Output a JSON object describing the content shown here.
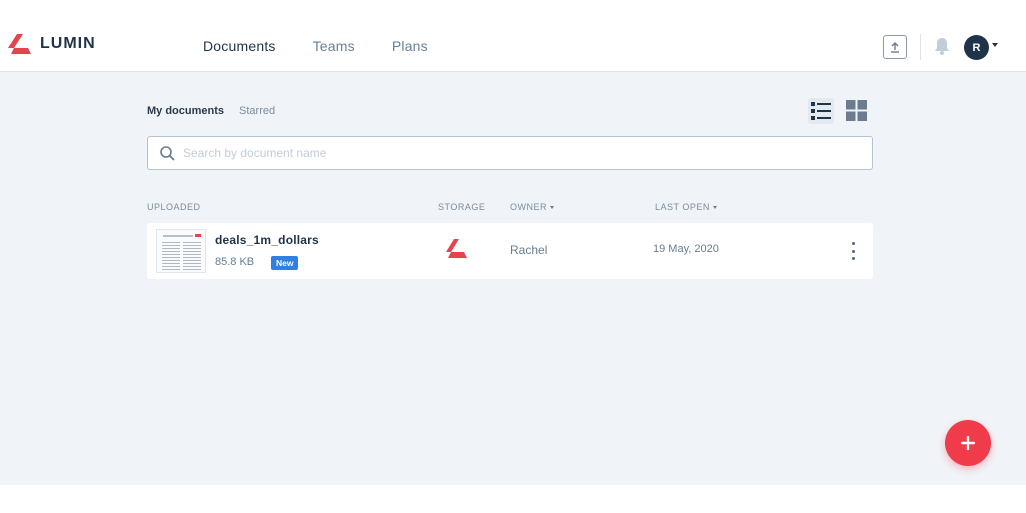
{
  "brand": {
    "name": "LUMIN",
    "accent": "#e5444f"
  },
  "nav": {
    "items": [
      {
        "label": "Documents",
        "active": true
      },
      {
        "label": "Teams",
        "active": false
      },
      {
        "label": "Plans",
        "active": false
      }
    ]
  },
  "header": {
    "upload_icon": "upload-icon",
    "notification_icon": "bell-icon",
    "avatar_initial": "R"
  },
  "subtabs": [
    {
      "label": "My documents",
      "active": true
    },
    {
      "label": "Starred",
      "active": false
    }
  ],
  "view_toggle": {
    "list_icon": "list-view-icon",
    "grid_icon": "grid-view-icon",
    "selected": "list"
  },
  "search": {
    "placeholder": "Search by document name",
    "value": ""
  },
  "table": {
    "columns": {
      "uploaded": "UPLOADED",
      "storage": "STORAGE",
      "owner": "OWNER",
      "last_open": "LAST OPEN"
    },
    "rows": [
      {
        "name": "deals_1m_dollars",
        "size": "85.8 KB",
        "badge": "New",
        "storage_icon": "lumin-storage-icon",
        "owner": "Rachel",
        "last_open": "19 May, 2020"
      }
    ]
  },
  "fab": {
    "icon": "plus-icon",
    "color": "#ef3b4a"
  }
}
